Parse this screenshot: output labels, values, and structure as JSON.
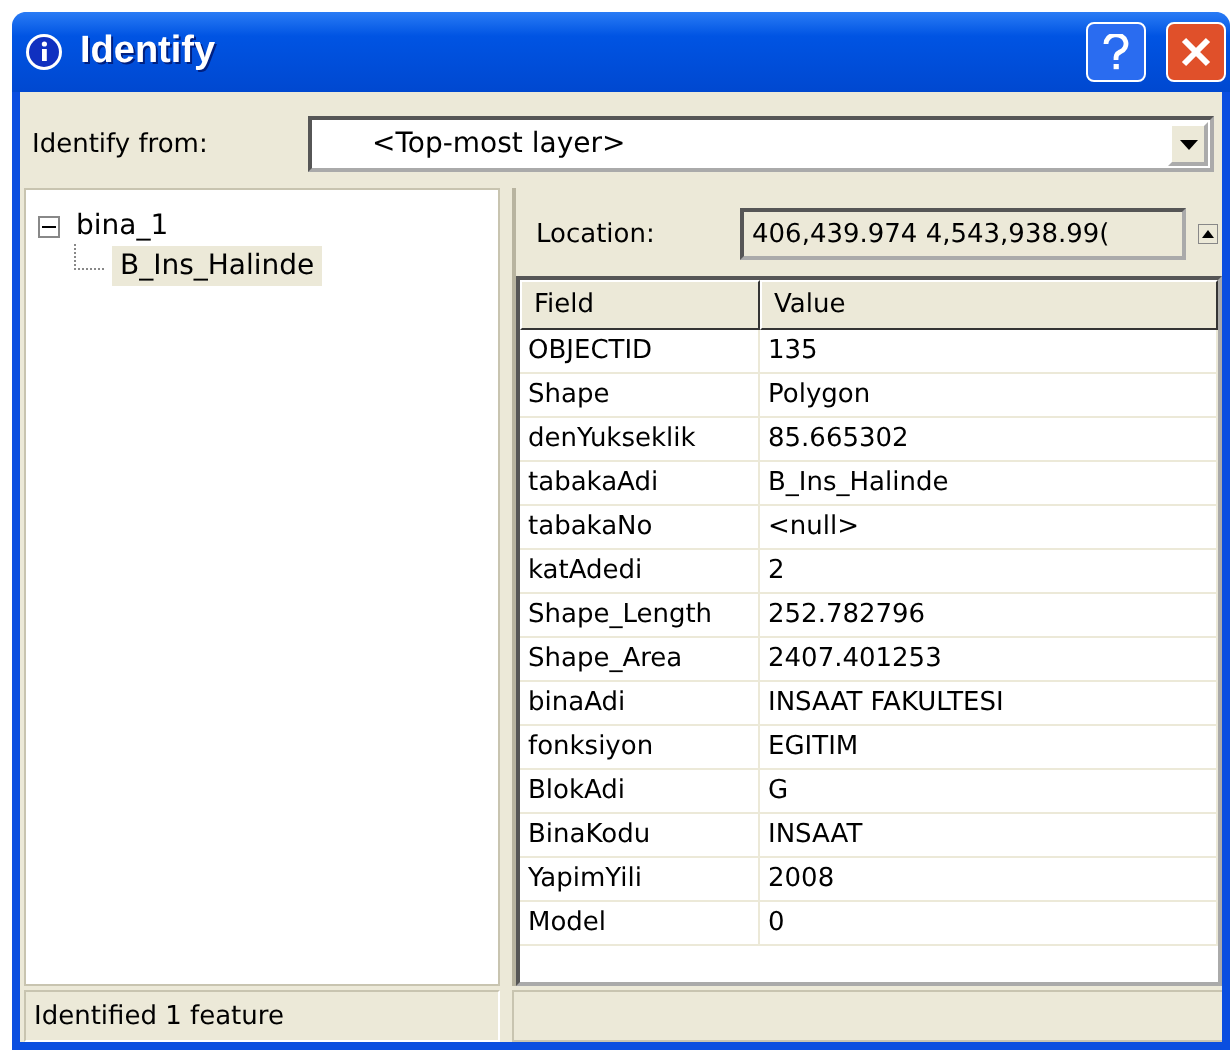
{
  "window": {
    "title": "Identify"
  },
  "identify_from": {
    "label": "Identify from:",
    "value": "<Top-most layer>"
  },
  "tree": [
    {
      "label": "bina_1",
      "expanded": true,
      "selected": false,
      "children": [
        {
          "label": "B_Ins_Halinde",
          "selected": true
        }
      ]
    }
  ],
  "location": {
    "label": "Location:",
    "value": "406,439.974  4,543,938.99("
  },
  "table": {
    "columns": [
      "Field",
      "Value"
    ],
    "rows": [
      [
        "OBJECTID",
        "135"
      ],
      [
        "Shape",
        "Polygon"
      ],
      [
        "denYukseklik",
        "85.665302"
      ],
      [
        "tabakaAdi",
        "B_Ins_Halinde"
      ],
      [
        "tabakaNo",
        "<null>"
      ],
      [
        "katAdedi",
        "2"
      ],
      [
        "Shape_Length",
        "252.782796"
      ],
      [
        "Shape_Area",
        "2407.401253"
      ],
      [
        "binaAdi",
        "INSAAT FAKULTESI"
      ],
      [
        "fonksiyon",
        "EGITIM"
      ],
      [
        "BlokAdi",
        "G"
      ],
      [
        "BinaKodu",
        "INSAAT"
      ],
      [
        "YapimYili",
        "2008"
      ],
      [
        "Model",
        "0"
      ]
    ]
  },
  "status_bar": "Identified 1 feature"
}
